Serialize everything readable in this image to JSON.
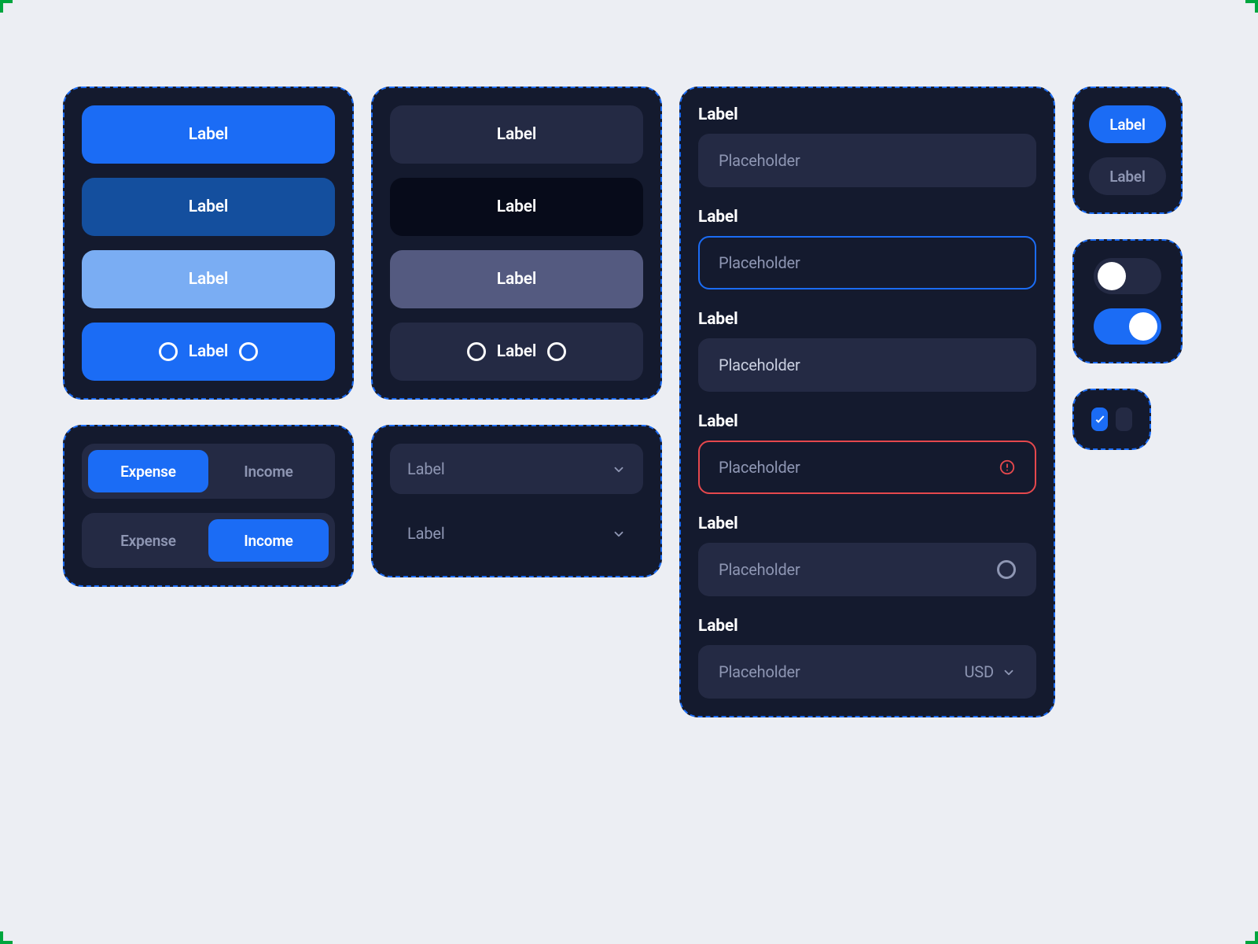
{
  "buttons_primary": {
    "b1": "Label",
    "b2": "Label",
    "b3": "Label",
    "b4": "Label"
  },
  "buttons_secondary": {
    "b1": "Label",
    "b2": "Label",
    "b3": "Label",
    "b4": "Label"
  },
  "segment_a": {
    "opt1": "Expense",
    "opt2": "Income"
  },
  "segment_b": {
    "opt1": "Expense",
    "opt2": "Income"
  },
  "select_filled": "Label",
  "select_ghost": "Label",
  "inputs": {
    "f1": {
      "label": "Label",
      "placeholder": "Placeholder"
    },
    "f2": {
      "label": "Label",
      "placeholder": "Placeholder"
    },
    "f3": {
      "label": "Label",
      "placeholder": "Placeholder"
    },
    "f4": {
      "label": "Label",
      "placeholder": "Placeholder"
    },
    "f5": {
      "label": "Label",
      "placeholder": "Placeholder"
    },
    "f6": {
      "label": "Label",
      "placeholder": "Placeholder",
      "currency": "USD"
    }
  },
  "chips": {
    "active": "Label",
    "inactive": "Label"
  }
}
